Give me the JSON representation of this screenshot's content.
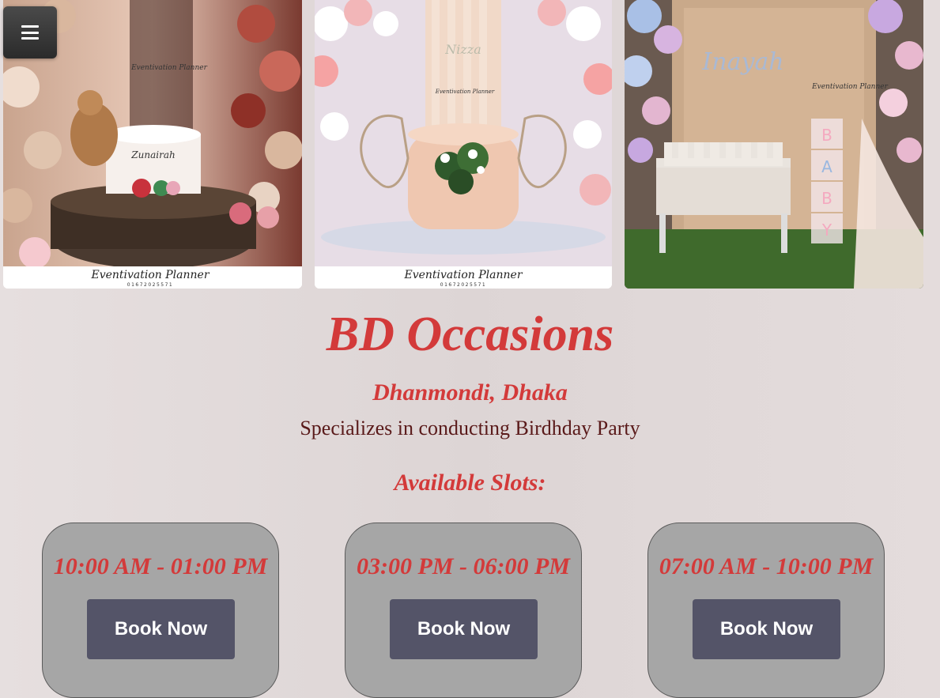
{
  "menu": {
    "icon": "hamburger-menu-icon"
  },
  "gallery": [
    {
      "name_text": "Zunairah",
      "brand": "Eventivation Planner",
      "phone": "01672025571"
    },
    {
      "name_text": "Nizza",
      "brand": "Eventivation Planner",
      "phone": "01672025571"
    },
    {
      "name_text": "Inayah",
      "brand": "Eventivation Planner",
      "baby_blocks": "BABY"
    }
  ],
  "venue": {
    "name": "BD Occasions",
    "location": "Dhanmondi, Dhaka",
    "specialty": "Specializes in conducting Birdhday Party"
  },
  "slots_heading": "Available Slots:",
  "slots": [
    {
      "time": "10:00 AM - 01:00 PM",
      "button": "Book Now"
    },
    {
      "time": "03:00 PM - 06:00 PM",
      "button": "Book Now"
    },
    {
      "time": "07:00 AM - 10:00 PM",
      "button": "Book Now"
    }
  ],
  "colors": {
    "accent": "#d33a3a",
    "button_bg": "#545468",
    "card_bg": "#a6a6a6"
  }
}
